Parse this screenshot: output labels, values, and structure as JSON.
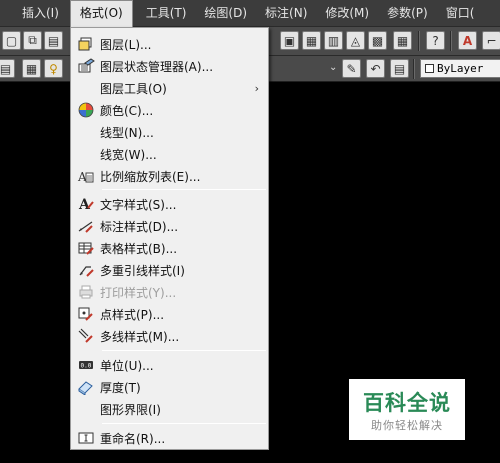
{
  "menubar": {
    "items": [
      {
        "label": "插入(I)"
      },
      {
        "label": "格式(O)",
        "active": true
      },
      {
        "label": "工具(T)"
      },
      {
        "label": "绘图(D)"
      },
      {
        "label": "标注(N)"
      },
      {
        "label": "修改(M)"
      },
      {
        "label": "参数(P)"
      },
      {
        "label": "窗口("
      }
    ]
  },
  "toolbar": {
    "layer_combo_value": "ByLayer"
  },
  "format_menu": {
    "items": [
      {
        "label": "图层(L)...",
        "icon": "layers-icon"
      },
      {
        "label": "图层状态管理器(A)...",
        "icon": "layer-states-icon"
      },
      {
        "label": "图层工具(O)",
        "icon": "",
        "submenu": true
      },
      {
        "label": "颜色(C)...",
        "icon": "color-wheel-icon"
      },
      {
        "label": "线型(N)...",
        "icon": ""
      },
      {
        "label": "线宽(W)...",
        "icon": ""
      },
      {
        "label": "比例缩放列表(E)...",
        "icon": "scale-list-icon"
      },
      {
        "label": "文字样式(S)...",
        "icon": "text-style-icon"
      },
      {
        "label": "标注样式(D)...",
        "icon": "dimension-style-icon"
      },
      {
        "label": "表格样式(B)...",
        "icon": "table-style-icon"
      },
      {
        "label": "多重引线样式(I)",
        "icon": "multileader-style-icon"
      },
      {
        "label": "打印样式(Y)...",
        "icon": "plot-style-icon",
        "disabled": true
      },
      {
        "label": "点样式(P)...",
        "icon": "point-style-icon"
      },
      {
        "label": "多线样式(M)...",
        "icon": "multiline-style-icon"
      },
      {
        "label": "单位(U)...",
        "icon": "units-icon"
      },
      {
        "label": "厚度(T)",
        "icon": "thickness-icon"
      },
      {
        "label": "图形界限(I)",
        "icon": ""
      },
      {
        "label": "重命名(R)...",
        "icon": "rename-icon"
      }
    ]
  },
  "watermark": {
    "title": "百科全说",
    "subtitle": "助你轻松解决"
  }
}
